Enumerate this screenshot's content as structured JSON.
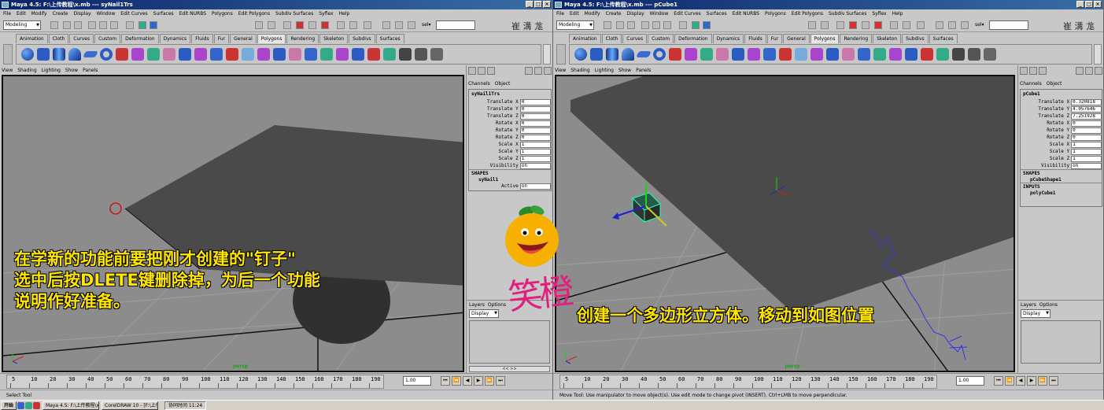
{
  "left_window": {
    "title": "Maya 4.5: F:\\上传教程\\x.mb  ---  syNail1Trs",
    "help_line": "Select Tool",
    "channel_box": {
      "object": "syNail1Trs",
      "channels": [
        {
          "label": "Translate X",
          "value": "0"
        },
        {
          "label": "Translate Y",
          "value": "0"
        },
        {
          "label": "Translate Z",
          "value": "0"
        },
        {
          "label": "Rotate X",
          "value": "0"
        },
        {
          "label": "Rotate Y",
          "value": "0"
        },
        {
          "label": "Rotate Z",
          "value": "0"
        },
        {
          "label": "Scale X",
          "value": "1"
        },
        {
          "label": "Scale Y",
          "value": "1"
        },
        {
          "label": "Scale Z",
          "value": "1"
        },
        {
          "label": "Visibility",
          "value": "on"
        }
      ],
      "shapes_header": "SHAPES",
      "shape_name": "syNail1",
      "shape_attr_label": "Active",
      "shape_attr_value": "on"
    }
  },
  "right_window": {
    "title": "Maya 4.5: F:\\上传教程\\x.mb  ---  pCube1",
    "help_line": "Move Tool: Use manipulator to move object(s). Use edit mode to change pivot (INSERT). Ctrl+LMB to move perpendicular.",
    "channel_box": {
      "object": "pCube1",
      "channels": [
        {
          "label": "Translate X",
          "value": "0.320818"
        },
        {
          "label": "Translate Y",
          "value": "4.057646"
        },
        {
          "label": "Translate Z",
          "value": "7.251928"
        },
        {
          "label": "Rotate X",
          "value": "0"
        },
        {
          "label": "Rotate Y",
          "value": "0"
        },
        {
          "label": "Rotate Z",
          "value": "0"
        },
        {
          "label": "Scale X",
          "value": "1"
        },
        {
          "label": "Scale Y",
          "value": "1"
        },
        {
          "label": "Scale Z",
          "value": "1"
        },
        {
          "label": "Visibility",
          "value": "on"
        }
      ],
      "shapes_header": "SHAPES",
      "shape_name": "pCubeShape1",
      "inputs_header": "INPUTS",
      "input_name": "polyCube1"
    }
  },
  "menu": [
    "File",
    "Edit",
    "Modify",
    "Create",
    "Display",
    "Window",
    "Edit Curves",
    "Surfaces",
    "Edit NURBS",
    "Polygons",
    "Edit Polygons",
    "Subdiv Surfaces",
    "Syflex",
    "Help"
  ],
  "mode_select": "Modeling",
  "sel_label": "sel▾",
  "shelf_tabs": [
    "Animation",
    "Cloth",
    "Curves",
    "Custom",
    "Deformation",
    "Dynamics",
    "Fluids",
    "Fur",
    "General",
    "Polygons",
    "Rendering",
    "Skeleton",
    "Subdivs",
    "Surfaces"
  ],
  "active_shelf_tab": "Polygons",
  "panel_menu": [
    "View",
    "Shading",
    "Lighting",
    "Show",
    "Panels"
  ],
  "channels_tabs": [
    "Channels",
    "Object"
  ],
  "layers_menu": [
    "Layers",
    "Options"
  ],
  "layers_display": "Display",
  "layer_scroll": "<<          >>",
  "persp_label": "persp",
  "timeline_ticks": [
    "5",
    "10",
    "20",
    "30",
    "40",
    "50",
    "60",
    "70",
    "80",
    "90",
    "100",
    "110",
    "120",
    "130",
    "140",
    "150",
    "160",
    "170",
    "180",
    "190"
  ],
  "current_frame": "1.00",
  "toolbar_kanji": "崔 溝 尨",
  "taskbar": {
    "start": "开始",
    "items": [
      "Maya 4.5: F:\\上传教程\\x...",
      "CorelDRAW 10 - [F:\\上传..."
    ],
    "tray": "协同时间 11:24"
  },
  "captions": {
    "left_lines": [
      "在学新的功能前要把刚才创建的\"钉子\"",
      "选中后按DLETE键删除掉，为后一个功能",
      "说明作好准备。"
    ],
    "right": "创建一个多边形立方体。移动到如图位置",
    "logo": "笑橙"
  },
  "colors": {
    "title_start": "#0a246a",
    "title_end": "#3a6ea5",
    "caption": "#ffe600",
    "logo": "#e0207e",
    "viewport": "#8c8c8c",
    "plane": "#4a4a4a"
  },
  "icons": [
    "app-icon",
    "minimize-icon",
    "maximize-icon",
    "close-icon",
    "sphere-icon",
    "cube-icon",
    "cylinder-icon",
    "cone-icon",
    "plane-icon",
    "torus-icon",
    "lock-icon",
    "trash-icon"
  ]
}
